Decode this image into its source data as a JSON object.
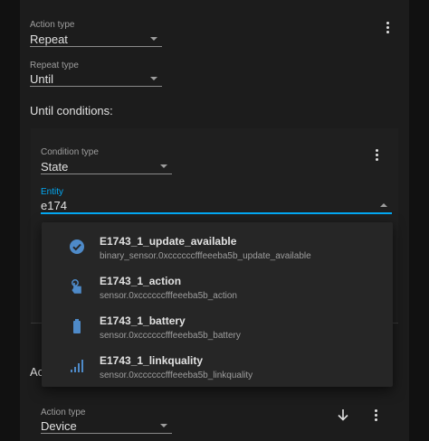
{
  "action": {
    "type_label": "Action type",
    "type_value": "Repeat",
    "repeat_type_label": "Repeat type",
    "repeat_type_value": "Until",
    "until_heading": "Until conditions:"
  },
  "condition": {
    "type_label": "Condition type",
    "type_value": "State",
    "entity_label": "Entity",
    "entity_value": "e174"
  },
  "dropdown": {
    "items": [
      {
        "name": "E1743_1_update_available",
        "entity_id": "binary_sensor.0xccccccfffeeeba5b_update_available",
        "icon": "check-circle-icon"
      },
      {
        "name": "E1743_1_action",
        "entity_id": "sensor.0xccccccfffeeeba5b_action",
        "icon": "gesture-tap-icon"
      },
      {
        "name": "E1743_1_battery",
        "entity_id": "sensor.0xccccccfffeeeba5b_battery",
        "icon": "battery-icon"
      },
      {
        "name": "E1743_1_linkquality",
        "entity_id": "sensor.0xccccccfffeeeba5b_linkquality",
        "icon": "signal-icon"
      }
    ]
  },
  "next_action": {
    "partial_label": "Ac",
    "type_label": "Action type",
    "type_value": "Device"
  },
  "colors": {
    "accent": "#03a9f4",
    "icon": "#4e8ac8"
  }
}
